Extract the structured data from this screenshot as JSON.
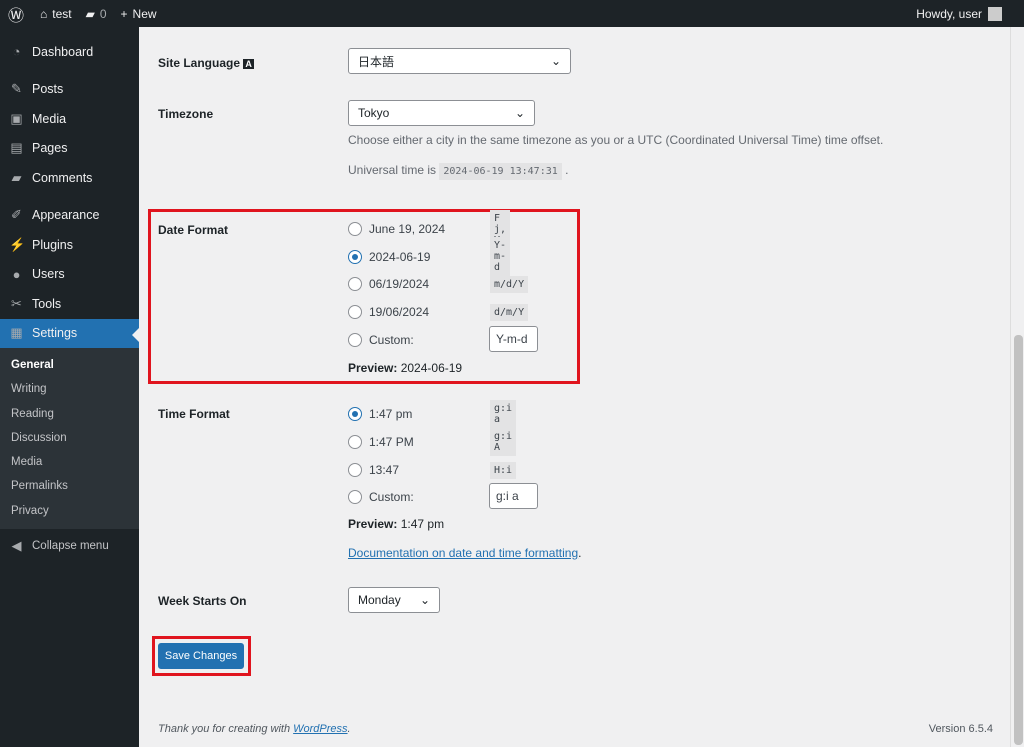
{
  "topbar": {
    "site": "test",
    "comments": "0",
    "new": "New",
    "howdy": "Howdy, user"
  },
  "sidebar": {
    "items": [
      {
        "label": "Dashboard",
        "icon": "dashboard-icon",
        "glyph": "◔"
      },
      {
        "label": "Posts",
        "icon": "pin-icon",
        "glyph": "✎"
      },
      {
        "label": "Media",
        "icon": "media-icon",
        "glyph": "▣"
      },
      {
        "label": "Pages",
        "icon": "pages-icon",
        "glyph": "▤"
      },
      {
        "label": "Comments",
        "icon": "comment-icon",
        "glyph": "▰"
      },
      {
        "label": "Appearance",
        "icon": "brush-icon",
        "glyph": "✐"
      },
      {
        "label": "Plugins",
        "icon": "plug-icon",
        "glyph": "⚡"
      },
      {
        "label": "Users",
        "icon": "user-icon",
        "glyph": "●"
      },
      {
        "label": "Tools",
        "icon": "wrench-icon",
        "glyph": "✂"
      },
      {
        "label": "Settings",
        "icon": "settings-icon",
        "glyph": "▦"
      }
    ],
    "submenu": [
      "General",
      "Writing",
      "Reading",
      "Discussion",
      "Media",
      "Permalinks",
      "Privacy"
    ],
    "collapse": "Collapse menu"
  },
  "form": {
    "site_language": {
      "label": "Site Language",
      "value": "日本語"
    },
    "timezone": {
      "label": "Timezone",
      "value": "Tokyo",
      "desc": "Choose either a city in the same timezone as you or a UTC (Coordinated Universal Time) time offset.",
      "utc_prefix": "Universal time is",
      "utc": "2024-06-19 13:47:31",
      "utc_suffix": "."
    },
    "date_format": {
      "label": "Date Format",
      "options": [
        {
          "label": "June 19, 2024",
          "code": "F j, Y",
          "checked": false
        },
        {
          "label": "2024-06-19",
          "code": "Y-m-d",
          "checked": true
        },
        {
          "label": "06/19/2024",
          "code": "m/d/Y",
          "checked": false
        },
        {
          "label": "19/06/2024",
          "code": "d/m/Y",
          "checked": false
        }
      ],
      "custom_label": "Custom:",
      "custom_value": "Y-m-d",
      "preview_label": "Preview:",
      "preview": "2024-06-19"
    },
    "time_format": {
      "label": "Time Format",
      "options": [
        {
          "label": "1:47 pm",
          "code": "g:i a",
          "checked": true
        },
        {
          "label": "1:47 PM",
          "code": "g:i A",
          "checked": false
        },
        {
          "label": "13:47",
          "code": "H:i",
          "checked": false
        }
      ],
      "custom_label": "Custom:",
      "custom_value": "g:i a",
      "preview_label": "Preview:",
      "preview": "1:47 pm"
    },
    "doc_link": "Documentation on date and time formatting",
    "week": {
      "label": "Week Starts On",
      "value": "Monday"
    },
    "save": "Save Changes"
  },
  "footer": {
    "thanks": "Thank you for creating with",
    "wp": "WordPress",
    "dot": ".",
    "version": "Version 6.5.4"
  }
}
